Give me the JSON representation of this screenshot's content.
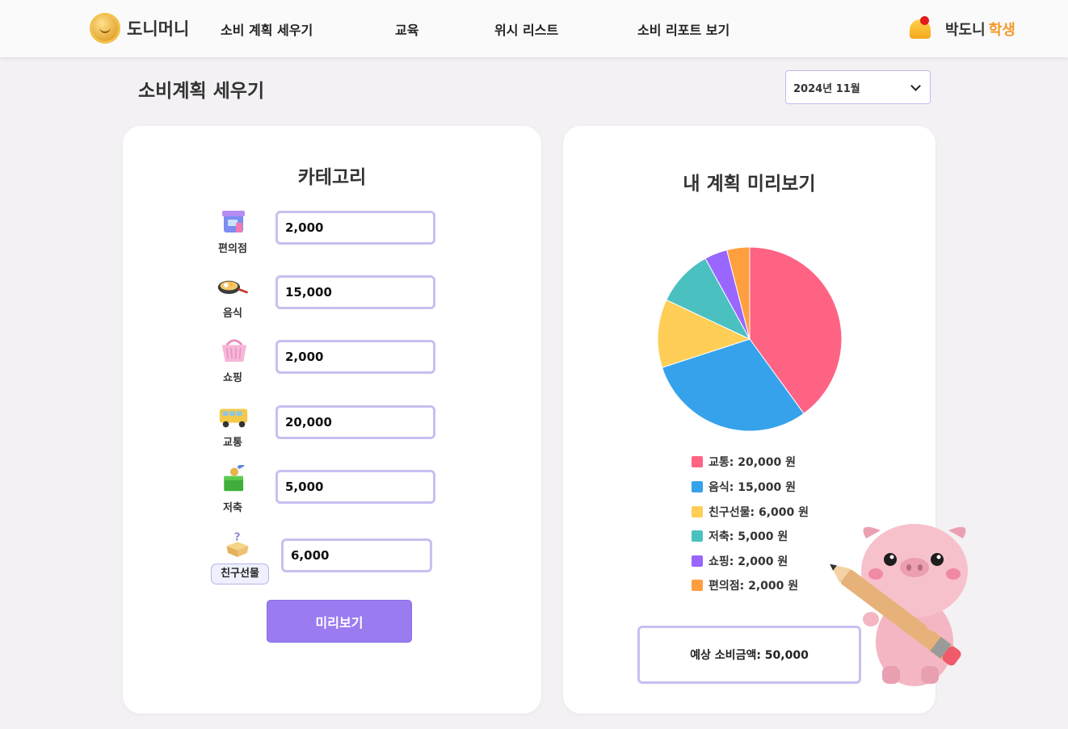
{
  "header": {
    "logo_text": "도니머니",
    "nav": [
      "소비 계획 세우기",
      "교육",
      "위시 리스트",
      "소비 리포트 보기"
    ],
    "user_name": "박도니",
    "user_role": "학생"
  },
  "page": {
    "title": "소비계획 세우기",
    "month": "2024년 11월"
  },
  "categories_card": {
    "title": "카테고리",
    "items": [
      {
        "icon": "store-icon",
        "label": "편의점",
        "value": "2,000"
      },
      {
        "icon": "frying-pan-icon",
        "label": "음식",
        "value": "15,000"
      },
      {
        "icon": "shopping-basket-icon",
        "label": "쇼핑",
        "value": "2,000"
      },
      {
        "icon": "bus-icon",
        "label": "교통",
        "value": "20,000"
      },
      {
        "icon": "piggy-bank-box-icon",
        "label": "저축",
        "value": "5,000"
      },
      {
        "icon": "mystery-box-icon",
        "label": "친구선물",
        "value": "6,000"
      }
    ],
    "preview_button": "미리보기"
  },
  "preview_card": {
    "title": "내 계획 미리보기",
    "legend": [
      {
        "text": "교통: 20,000 원",
        "color": "#ff6384"
      },
      {
        "text": "음식: 15,000 원",
        "color": "#36a2eb"
      },
      {
        "text": "친구선물: 6,000 원",
        "color": "#ffce56"
      },
      {
        "text": "저축: 5,000 원",
        "color": "#4bc0c0"
      },
      {
        "text": "쇼핑: 2,000 원",
        "color": "#9966ff"
      },
      {
        "text": "편의점: 2,000 원",
        "color": "#ff9f40"
      }
    ],
    "total_text": "예상 소비금액: 50,000"
  },
  "chart_data": {
    "type": "pie",
    "categories": [
      "교통",
      "음식",
      "친구선물",
      "저축",
      "쇼핑",
      "편의점"
    ],
    "values": [
      20000,
      15000,
      6000,
      5000,
      2000,
      2000
    ],
    "colors": [
      "#ff6384",
      "#36a2eb",
      "#ffce56",
      "#4bc0c0",
      "#9966ff",
      "#ff9f40"
    ],
    "legend": "bottom"
  }
}
